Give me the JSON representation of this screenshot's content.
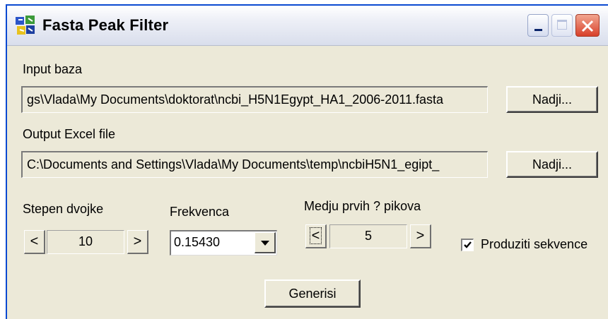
{
  "window": {
    "title": "Fasta Peak Filter",
    "icon": "app-icon"
  },
  "input_section": {
    "label": "Input baza",
    "value": "gs\\Vlada\\My Documents\\doktorat\\ncbi_H5N1Egypt_HA1_2006-2011.fasta",
    "browse_label": "Nadji..."
  },
  "output_section": {
    "label": "Output Excel file",
    "value": "C:\\Documents and Settings\\Vlada\\My Documents\\temp\\ncbiH5N1_egipt_",
    "browse_label": "Nadji..."
  },
  "stepen": {
    "label": "Stepen dvojke",
    "value": "10",
    "left_arrow": "<",
    "right_arrow": ">"
  },
  "frekvenca": {
    "label": "Frekvenca",
    "value": "0.15430"
  },
  "medju": {
    "label": "Medju prvih ? pikova",
    "value": "5",
    "left_arrow": "<",
    "right_arrow": ">"
  },
  "produziti": {
    "label": "Produziti sekvence",
    "checked": true
  },
  "generate_label": "Generisi"
}
